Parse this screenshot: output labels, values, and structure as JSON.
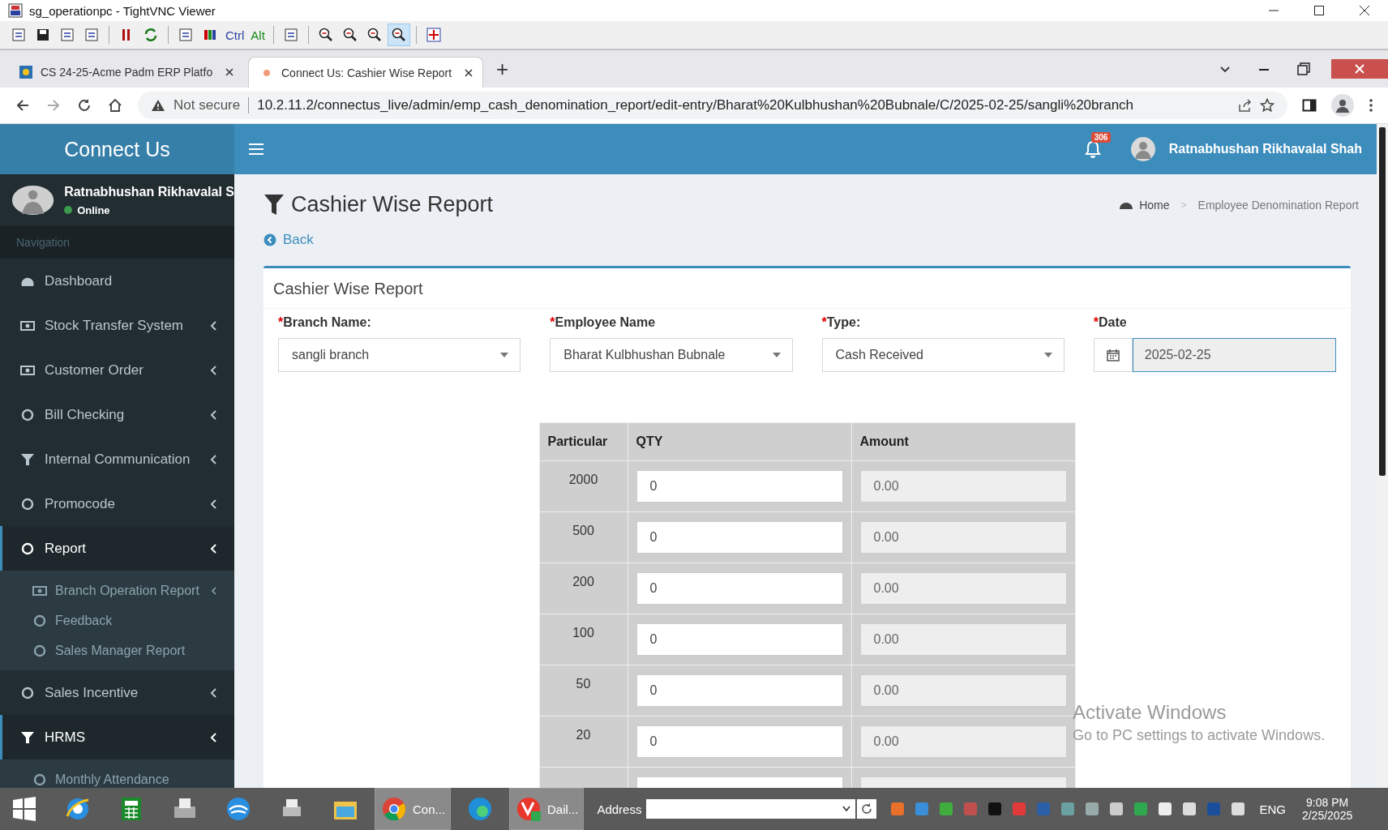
{
  "vnc": {
    "title": "sg_operationpc - TightVNC Viewer",
    "toolbar": [
      {
        "items": [
          {
            "kind": "connection",
            "selected": false
          },
          {
            "kind": "save",
            "selected": false
          },
          {
            "kind": "options",
            "selected": false
          },
          {
            "kind": "info",
            "selected": false
          }
        ]
      },
      {
        "items": [
          {
            "kind": "pause",
            "selected": false
          },
          {
            "kind": "refresh",
            "selected": false
          }
        ]
      },
      {
        "items": [
          {
            "kind": "keys",
            "selected": false
          },
          {
            "kind": "colors",
            "selected": false
          },
          {
            "kind": "ctrl",
            "label": "Ctrl",
            "selected": false
          },
          {
            "kind": "alt",
            "label": "Alt",
            "selected": false
          }
        ]
      },
      {
        "items": [
          {
            "kind": "copy",
            "selected": false
          }
        ]
      },
      {
        "items": [
          {
            "kind": "zoom-in",
            "selected": false
          },
          {
            "kind": "zoom-out",
            "selected": false
          },
          {
            "kind": "zoom-100",
            "selected": false
          },
          {
            "kind": "zoom-auto",
            "selected": true
          }
        ]
      },
      {
        "items": [
          {
            "kind": "fullscreen",
            "selected": false
          }
        ]
      }
    ]
  },
  "browser": {
    "tabs": [
      {
        "title": "CS 24-25-Acme Padm ERP Platfo",
        "selected": false
      },
      {
        "title": "Connect Us: Cashier Wise Report",
        "selected": true
      }
    ],
    "new_tab": "+",
    "security": "Not secure",
    "url": "10.2.11.2/connectus_live/admin/emp_cash_denomination_report/edit-entry/Bharat%20Kulbhushan%20Bubnale/C/2025-02-25/sangli%20branch"
  },
  "app": {
    "brand": "Connect Us",
    "user_name": "Ratnabhushan Rikhavalal Shah",
    "notification_count": "306",
    "sidebar": {
      "user_name": "Ratnabhushan Rikhavalal S",
      "status": "Online",
      "nav_header": "Navigation",
      "items": [
        {
          "label": "Dashboard",
          "kind": "dashboard",
          "expandable": false,
          "active": false
        },
        {
          "label": "Stock Transfer System",
          "kind": "money",
          "expandable": true,
          "active": false
        },
        {
          "label": "Customer Order",
          "kind": "money",
          "expandable": true,
          "active": false
        },
        {
          "label": "Bill Checking",
          "kind": "circle",
          "expandable": true,
          "active": false
        },
        {
          "label": "Internal Communication",
          "kind": "filter",
          "expandable": true,
          "active": false
        },
        {
          "label": "Promocode",
          "kind": "circle",
          "expandable": true,
          "active": false
        },
        {
          "label": "Report",
          "kind": "circle",
          "expandable": true,
          "active": true,
          "children": [
            {
              "label": "Branch Operation Report",
              "kind": "money",
              "expandable": true
            },
            {
              "label": "Feedback",
              "kind": "circle",
              "expandable": false
            },
            {
              "label": "Sales Manager Report",
              "kind": "circle",
              "expandable": false
            }
          ]
        },
        {
          "label": "Sales Incentive",
          "kind": "circle",
          "expandable": true,
          "active": false
        },
        {
          "label": "HRMS",
          "kind": "filter",
          "expandable": true,
          "active": true,
          "children": [
            {
              "label": "Monthly Attendance",
              "kind": "circle",
              "expandable": false
            }
          ]
        }
      ]
    },
    "page_title": "Cashier Wise Report",
    "back": "Back",
    "breadcrumb": {
      "items": [
        "Home",
        "Employee Denomination Report"
      ],
      "separator": ">"
    },
    "card_title": "Cashier Wise Report",
    "fields": [
      {
        "kind": "select",
        "required_mark": "*",
        "label": "Branch Name:",
        "value": "sangli branch",
        "focused": false
      },
      {
        "kind": "select",
        "required_mark": "*",
        "label": "Employee Name",
        "value": "Bharat Kulbhushan Bubnale",
        "focused": false
      },
      {
        "kind": "select",
        "required_mark": "*",
        "label": "Type:",
        "value": "Cash Received",
        "focused": false
      },
      {
        "kind": "date",
        "required_mark": "*",
        "label": "Date",
        "value": "2025-02-25",
        "focused": true
      }
    ],
    "table": {
      "columns": [
        "Particular",
        "QTY",
        "Amount"
      ],
      "rows": [
        {
          "particular": "2000",
          "qty": "0",
          "amount": "0.00"
        },
        {
          "particular": "500",
          "qty": "0",
          "amount": "0.00"
        },
        {
          "particular": "200",
          "qty": "0",
          "amount": "0.00"
        },
        {
          "particular": "100",
          "qty": "0",
          "amount": "0.00"
        },
        {
          "particular": "50",
          "qty": "0",
          "amount": "0.00"
        },
        {
          "particular": "20",
          "qty": "0",
          "amount": "0.00"
        }
      ]
    }
  },
  "activation": {
    "title": "Activate Windows",
    "message": "Go to PC settings to activate Windows."
  },
  "taskbar": {
    "apps": [
      {
        "kind": "ie",
        "active": false
      },
      {
        "kind": "calc",
        "active": false
      },
      {
        "kind": "fax",
        "active": false
      },
      {
        "kind": "bird",
        "active": false
      },
      {
        "kind": "printer",
        "active": false
      },
      {
        "kind": "folder",
        "active": false
      },
      {
        "kind": "chrome",
        "label": "Con...",
        "active": true
      },
      {
        "kind": "edge",
        "active": false
      },
      {
        "kind": "vs",
        "label": "Dail...",
        "active": true
      }
    ],
    "address_label": "Address",
    "language": "ENG",
    "time": "9:08 PM",
    "date": "2/25/2025"
  }
}
